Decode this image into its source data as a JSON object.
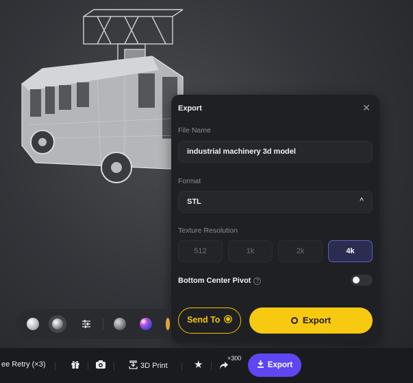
{
  "dialog": {
    "title": "Export",
    "close_glyph": "✕",
    "file_name_label": "File Name",
    "file_name_value": "industrial machinery 3d model",
    "format_label": "Format",
    "format_value": "STL",
    "format_chevron": "^",
    "texture_label": "Texture Resolution",
    "resolutions": [
      "512",
      "1k",
      "2k",
      "4k"
    ],
    "selected_resolution": "4k",
    "pivot_label": "Bottom Center Pivot",
    "pivot_help_glyph": "?",
    "pivot_enabled": false,
    "send_to_label": "Send To",
    "export_label": "Export"
  },
  "bottom_bar": {
    "retry_label": "ee Retry (×3)",
    "print_label": "3D Print",
    "share_badge": "+300",
    "export_label": "Export"
  },
  "icons": {
    "close": "close-icon",
    "chevron": "chevron-up-icon",
    "help": "help-icon",
    "send": "cube-icon",
    "export": "ring-icon",
    "gift": "gift-icon",
    "camera": "camera-icon",
    "print": "print-icon",
    "star": "star-icon",
    "share": "share-icon",
    "download": "download-icon"
  },
  "colors": {
    "accent_yellow": "#f8c911",
    "accent_purple": "#5e47f2",
    "selected_res_border": "#5a5cc8"
  }
}
